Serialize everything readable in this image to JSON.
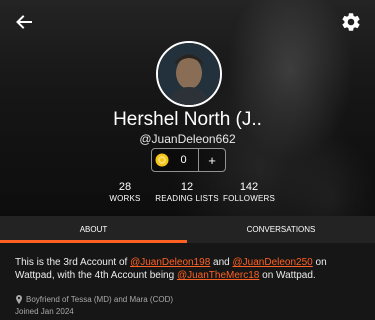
{
  "profile": {
    "display_name": "Hershel North (J..",
    "handle": "@JuanDeleon662",
    "coins": "0",
    "add_label": "+"
  },
  "stats": [
    {
      "value": "28",
      "label": "WORKS"
    },
    {
      "value": "12",
      "label": "READING LISTS"
    },
    {
      "value": "142",
      "label": "FOLLOWERS"
    }
  ],
  "tabs": [
    {
      "label": "ABOUT",
      "active": true
    },
    {
      "label": "CONVERSATIONS",
      "active": false
    }
  ],
  "about": {
    "part1": "This is the 3rd Account of ",
    "link1": "@JuanDeleon198",
    "part2": " and ",
    "link2": "@JuanDeleon250",
    "part3": " on Wattpad, with the 4th Account being ",
    "link3": "@JuanTheMerc18",
    "part4": " on Wattpad.",
    "location": "Boyfriend of Tessa (MD) and Mara (COD)",
    "joined": "Joined Jan 2024"
  },
  "colors": {
    "accent": "#ff6122",
    "background": "#161616",
    "tab_bar": "#232323"
  },
  "icons": {
    "back": "arrow-left-icon",
    "settings": "gear-icon",
    "coin": "coin-icon",
    "location": "location-pin-icon"
  }
}
